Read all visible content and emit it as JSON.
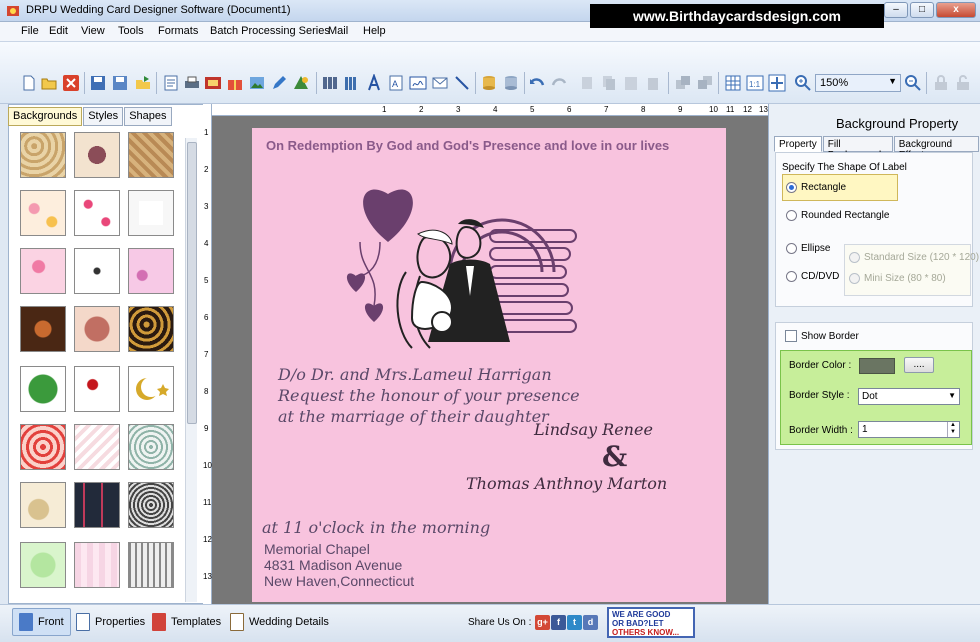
{
  "window": {
    "title": "DRPU Wedding Card Designer Software (Document1)",
    "watermark": "www.Birthdaycardsdesign.com",
    "minimize": "–",
    "restore": "□",
    "close": "x"
  },
  "menu": [
    "File",
    "Edit",
    "View",
    "Tools",
    "Formats",
    "Batch Processing Series",
    "Mail",
    "Help"
  ],
  "toolbar": {
    "zoom": "150%"
  },
  "left_panel": {
    "tabs": [
      "Backgrounds",
      "Styles",
      "Shapes"
    ],
    "active_tab": "Backgrounds"
  },
  "rulers": {
    "horizontal": [
      "1",
      "2",
      "3",
      "4",
      "5",
      "6",
      "7",
      "8",
      "9",
      "10",
      "11",
      "12",
      "13"
    ],
    "vertical": [
      "1",
      "2",
      "3",
      "4",
      "5",
      "6",
      "7",
      "8",
      "9",
      "10",
      "11",
      "12",
      "13"
    ]
  },
  "card": {
    "redemption": "On Redemption By God and God's Presence and love in our lives",
    "line1": "D/o Dr. and Mrs.Lameul Harrigan",
    "line2": "Request the honour of your presence",
    "line3": "at the marriage of their daughter",
    "bride": "Lindsay  Renee",
    "amp": "&",
    "groom": "Thomas  Anthnoy  Marton",
    "time": "at 11 o'clock in the morning",
    "venue1": "Memorial Chapel",
    "venue2": "4831 Madison Avenue",
    "venue3": "New Haven,Connecticut"
  },
  "right_panel": {
    "title": "Background Property",
    "tabs": [
      "Property",
      "Fill Background",
      "Background Effects"
    ],
    "active_tab": "Property",
    "shape_legend": "Specify The Shape Of Label",
    "shapes": [
      "Rectangle",
      "Rounded Rectangle",
      "Ellipse",
      "CD/DVD"
    ],
    "selected_shape": "Rectangle",
    "sizes": [
      "Standard Size (120 * 120)",
      "Mini Size (80 * 80)"
    ],
    "show_border_label": "Show Border",
    "show_border_checked": false,
    "border_color_label": "Border Color :",
    "border_color_value": "#6a7562",
    "browse_button": "....",
    "border_style_label": "Border Style :",
    "border_style_value": "Dot",
    "border_width_label": "Border Width :",
    "border_width_value": "1"
  },
  "bottom_bar": {
    "tabs": [
      "Front",
      "Properties",
      "Templates",
      "Wedding Details"
    ],
    "active_tab": "Front",
    "share_label": "Share Us On :",
    "social": [
      "g+",
      "f",
      "t",
      "d"
    ],
    "feedback": [
      "WE ARE GOOD",
      "OR BAD?LET",
      "OTHERS KNOW..."
    ]
  },
  "colors": {
    "card_background": "#f8c3de",
    "card_text": "#5a4868",
    "highlight_green": "#c7ee9a",
    "active_tab": "#fff9d6"
  }
}
